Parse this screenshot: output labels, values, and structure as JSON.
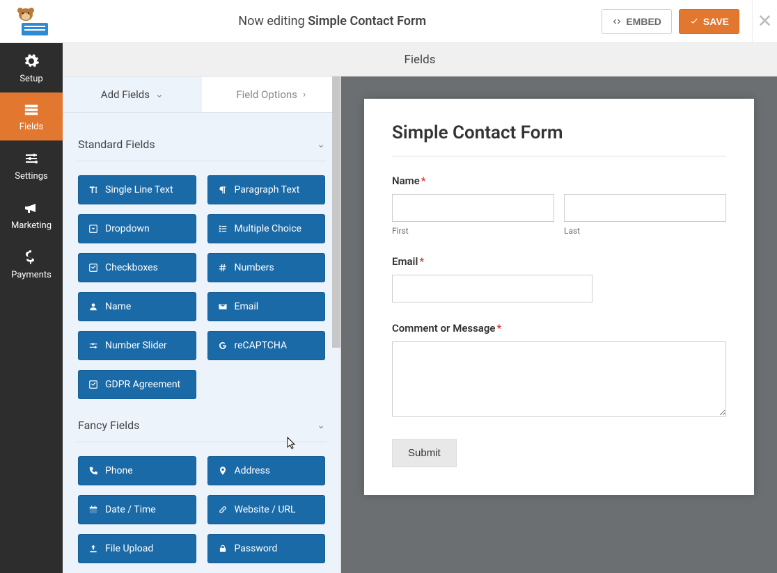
{
  "header": {
    "editing_prefix": "Now editing ",
    "form_name": "Simple Contact Form",
    "embed_label": "EMBED",
    "save_label": "SAVE"
  },
  "leftnav": {
    "items": [
      {
        "label": "Setup",
        "icon": "gear"
      },
      {
        "label": "Fields",
        "icon": "list"
      },
      {
        "label": "Settings",
        "icon": "sliders"
      },
      {
        "label": "Marketing",
        "icon": "bullhorn"
      },
      {
        "label": "Payments",
        "icon": "dollar"
      }
    ],
    "active_index": 1
  },
  "section_title": "Fields",
  "panel": {
    "tabs": {
      "add_fields": "Add Fields",
      "field_options": "Field Options"
    },
    "groups": [
      {
        "title": "Standard Fields",
        "fields": [
          {
            "label": "Single Line Text",
            "icon": "text-height"
          },
          {
            "label": "Paragraph Text",
            "icon": "paragraph"
          },
          {
            "label": "Dropdown",
            "icon": "caret-square"
          },
          {
            "label": "Multiple Choice",
            "icon": "list-ul"
          },
          {
            "label": "Checkboxes",
            "icon": "check-square"
          },
          {
            "label": "Numbers",
            "icon": "hash"
          },
          {
            "label": "Name",
            "icon": "user"
          },
          {
            "label": "Email",
            "icon": "envelope"
          },
          {
            "label": "Number Slider",
            "icon": "sliders-h"
          },
          {
            "label": "reCAPTCHA",
            "icon": "google"
          },
          {
            "label": "GDPR Agreement",
            "icon": "check-square"
          }
        ]
      },
      {
        "title": "Fancy Fields",
        "fields": [
          {
            "label": "Phone",
            "icon": "phone"
          },
          {
            "label": "Address",
            "icon": "map-marker"
          },
          {
            "label": "Date / Time",
            "icon": "calendar"
          },
          {
            "label": "Website / URL",
            "icon": "link"
          },
          {
            "label": "File Upload",
            "icon": "upload"
          },
          {
            "label": "Password",
            "icon": "lock"
          }
        ]
      }
    ]
  },
  "form_preview": {
    "title": "Simple Contact Form",
    "name_label": "Name",
    "first_sublabel": "First",
    "last_sublabel": "Last",
    "email_label": "Email",
    "comment_label": "Comment or Message",
    "submit_label": "Submit"
  }
}
